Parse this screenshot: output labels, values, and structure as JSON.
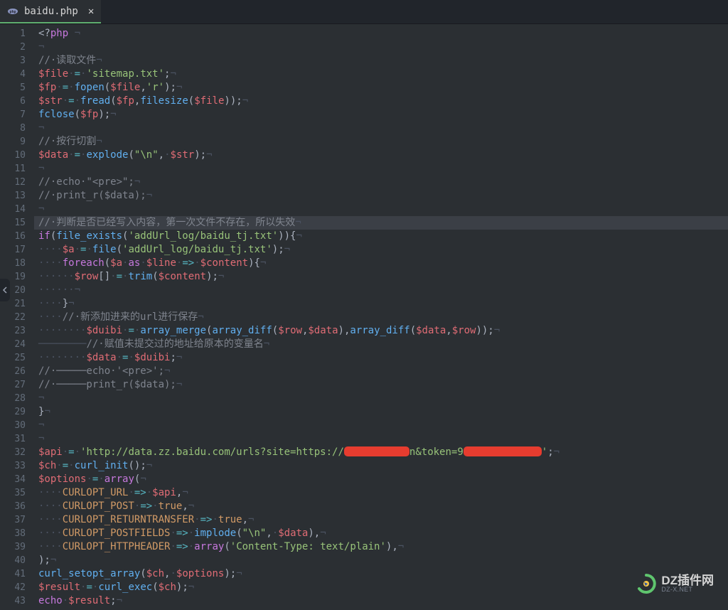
{
  "tab": {
    "filename": "baidu.php",
    "close": "✕"
  },
  "watermark": {
    "main": "DZ插件网",
    "sub": "DZ-X.NET"
  },
  "lines": [
    {
      "n": 1,
      "seg": [
        {
          "c": "t-pl",
          "t": "<?"
        },
        {
          "c": "t-kw",
          "t": "php"
        },
        {
          "c": "t-ws",
          "t": " ¬"
        }
      ]
    },
    {
      "n": 2,
      "seg": [
        {
          "c": "t-ws",
          "t": "¬"
        }
      ]
    },
    {
      "n": 3,
      "seg": [
        {
          "c": "t-cm",
          "t": "//·读取文件"
        },
        {
          "c": "t-ws",
          "t": "¬"
        }
      ]
    },
    {
      "n": 4,
      "seg": [
        {
          "c": "t-var",
          "t": "$file"
        },
        {
          "c": "t-ws",
          "t": "·"
        },
        {
          "c": "t-op",
          "t": "="
        },
        {
          "c": "t-ws",
          "t": "·"
        },
        {
          "c": "t-str",
          "t": "'sitemap.txt'"
        },
        {
          "c": "t-pl",
          "t": ";"
        },
        {
          "c": "t-ws",
          "t": "¬"
        }
      ]
    },
    {
      "n": 5,
      "seg": [
        {
          "c": "t-var",
          "t": "$fp"
        },
        {
          "c": "t-ws",
          "t": "·"
        },
        {
          "c": "t-op",
          "t": "="
        },
        {
          "c": "t-ws",
          "t": "·"
        },
        {
          "c": "t-fn",
          "t": "fopen"
        },
        {
          "c": "t-pl",
          "t": "("
        },
        {
          "c": "t-var",
          "t": "$file"
        },
        {
          "c": "t-pl",
          "t": ","
        },
        {
          "c": "t-str",
          "t": "'r'"
        },
        {
          "c": "t-pl",
          "t": ");"
        },
        {
          "c": "t-ws",
          "t": "¬"
        }
      ]
    },
    {
      "n": 6,
      "seg": [
        {
          "c": "t-var",
          "t": "$str"
        },
        {
          "c": "t-ws",
          "t": "·"
        },
        {
          "c": "t-op",
          "t": "="
        },
        {
          "c": "t-ws",
          "t": "·"
        },
        {
          "c": "t-fn",
          "t": "fread"
        },
        {
          "c": "t-pl",
          "t": "("
        },
        {
          "c": "t-var",
          "t": "$fp"
        },
        {
          "c": "t-pl",
          "t": ","
        },
        {
          "c": "t-fn",
          "t": "filesize"
        },
        {
          "c": "t-pl",
          "t": "("
        },
        {
          "c": "t-var",
          "t": "$file"
        },
        {
          "c": "t-pl",
          "t": "));"
        },
        {
          "c": "t-ws",
          "t": "¬"
        }
      ]
    },
    {
      "n": 7,
      "seg": [
        {
          "c": "t-fn",
          "t": "fclose"
        },
        {
          "c": "t-pl",
          "t": "("
        },
        {
          "c": "t-var",
          "t": "$fp"
        },
        {
          "c": "t-pl",
          "t": ");"
        },
        {
          "c": "t-ws",
          "t": "¬"
        }
      ]
    },
    {
      "n": 8,
      "seg": [
        {
          "c": "t-ws",
          "t": "¬"
        }
      ]
    },
    {
      "n": 9,
      "seg": [
        {
          "c": "t-cm",
          "t": "//·按行切割"
        },
        {
          "c": "t-ws",
          "t": "¬"
        }
      ]
    },
    {
      "n": 10,
      "seg": [
        {
          "c": "t-var",
          "t": "$data"
        },
        {
          "c": "t-ws",
          "t": "·"
        },
        {
          "c": "t-op",
          "t": "="
        },
        {
          "c": "t-ws",
          "t": "·"
        },
        {
          "c": "t-fn",
          "t": "explode"
        },
        {
          "c": "t-pl",
          "t": "("
        },
        {
          "c": "t-str",
          "t": "\"\\n\""
        },
        {
          "c": "t-pl",
          "t": ","
        },
        {
          "c": "t-ws",
          "t": "·"
        },
        {
          "c": "t-var",
          "t": "$str"
        },
        {
          "c": "t-pl",
          "t": ");"
        },
        {
          "c": "t-ws",
          "t": "¬"
        }
      ]
    },
    {
      "n": 11,
      "seg": [
        {
          "c": "t-ws",
          "t": "¬"
        }
      ]
    },
    {
      "n": 12,
      "seg": [
        {
          "c": "t-cm",
          "t": "//·echo·\"<pre>\";"
        },
        {
          "c": "t-ws",
          "t": "¬"
        }
      ]
    },
    {
      "n": 13,
      "seg": [
        {
          "c": "t-cm",
          "t": "//·print_r($data);"
        },
        {
          "c": "t-ws",
          "t": "¬"
        }
      ]
    },
    {
      "n": 14,
      "seg": [
        {
          "c": "t-ws",
          "t": "¬"
        }
      ]
    },
    {
      "n": 15,
      "hl": true,
      "seg": [
        {
          "c": "t-cm",
          "t": "//·判断是否已经写入内容，第一次文件不存在，所以失效"
        },
        {
          "c": "t-ws",
          "t": "¬"
        }
      ]
    },
    {
      "n": 16,
      "fold": true,
      "seg": [
        {
          "c": "t-kw",
          "t": "if"
        },
        {
          "c": "t-pl",
          "t": "("
        },
        {
          "c": "t-fn",
          "t": "file_exists"
        },
        {
          "c": "t-pl",
          "t": "("
        },
        {
          "c": "t-str",
          "t": "'addUrl_log/baidu_tj.txt'"
        },
        {
          "c": "t-pl",
          "t": ")){"
        },
        {
          "c": "t-ws",
          "t": "¬"
        }
      ]
    },
    {
      "n": 17,
      "seg": [
        {
          "c": "t-ws",
          "t": "····"
        },
        {
          "c": "t-var",
          "t": "$a"
        },
        {
          "c": "t-ws",
          "t": "·"
        },
        {
          "c": "t-op",
          "t": "="
        },
        {
          "c": "t-ws",
          "t": "·"
        },
        {
          "c": "t-fn",
          "t": "file"
        },
        {
          "c": "t-pl",
          "t": "("
        },
        {
          "c": "t-str",
          "t": "'addUrl_log/baidu_tj.txt'"
        },
        {
          "c": "t-pl",
          "t": ");"
        },
        {
          "c": "t-ws",
          "t": "¬"
        }
      ]
    },
    {
      "n": 18,
      "fold": true,
      "seg": [
        {
          "c": "t-ws",
          "t": "····"
        },
        {
          "c": "t-kw",
          "t": "foreach"
        },
        {
          "c": "t-pl",
          "t": "("
        },
        {
          "c": "t-var",
          "t": "$a"
        },
        {
          "c": "t-ws",
          "t": "·"
        },
        {
          "c": "t-kw",
          "t": "as"
        },
        {
          "c": "t-ws",
          "t": "·"
        },
        {
          "c": "t-var",
          "t": "$line"
        },
        {
          "c": "t-ws",
          "t": "·"
        },
        {
          "c": "t-op",
          "t": "=>"
        },
        {
          "c": "t-ws",
          "t": "·"
        },
        {
          "c": "t-var",
          "t": "$content"
        },
        {
          "c": "t-pl",
          "t": "){"
        },
        {
          "c": "t-ws",
          "t": "¬"
        }
      ]
    },
    {
      "n": 19,
      "seg": [
        {
          "c": "t-ws",
          "t": "······"
        },
        {
          "c": "t-var",
          "t": "$row"
        },
        {
          "c": "t-pl",
          "t": "[]"
        },
        {
          "c": "t-ws",
          "t": "·"
        },
        {
          "c": "t-op",
          "t": "="
        },
        {
          "c": "t-ws",
          "t": "·"
        },
        {
          "c": "t-fn",
          "t": "trim"
        },
        {
          "c": "t-pl",
          "t": "("
        },
        {
          "c": "t-var",
          "t": "$content"
        },
        {
          "c": "t-pl",
          "t": ");"
        },
        {
          "c": "t-ws",
          "t": "¬"
        }
      ]
    },
    {
      "n": 20,
      "seg": [
        {
          "c": "t-ws",
          "t": "······¬"
        }
      ]
    },
    {
      "n": 21,
      "seg": [
        {
          "c": "t-ws",
          "t": "····"
        },
        {
          "c": "t-pl",
          "t": "}"
        },
        {
          "c": "t-ws",
          "t": "¬"
        }
      ]
    },
    {
      "n": 22,
      "seg": [
        {
          "c": "t-ws",
          "t": "····"
        },
        {
          "c": "t-cm",
          "t": "//·新添加进来的url进行保存"
        },
        {
          "c": "t-ws",
          "t": "¬"
        }
      ]
    },
    {
      "n": 23,
      "seg": [
        {
          "c": "t-ws",
          "t": "········"
        },
        {
          "c": "t-var",
          "t": "$duibi"
        },
        {
          "c": "t-ws",
          "t": "·"
        },
        {
          "c": "t-op",
          "t": "="
        },
        {
          "c": "t-ws",
          "t": "·"
        },
        {
          "c": "t-fn",
          "t": "array_merge"
        },
        {
          "c": "t-pl",
          "t": "("
        },
        {
          "c": "t-fn",
          "t": "array_diff"
        },
        {
          "c": "t-pl",
          "t": "("
        },
        {
          "c": "t-var",
          "t": "$row"
        },
        {
          "c": "t-pl",
          "t": ","
        },
        {
          "c": "t-var",
          "t": "$data"
        },
        {
          "c": "t-pl",
          "t": "),"
        },
        {
          "c": "t-fn",
          "t": "array_diff"
        },
        {
          "c": "t-pl",
          "t": "("
        },
        {
          "c": "t-var",
          "t": "$data"
        },
        {
          "c": "t-pl",
          "t": ","
        },
        {
          "c": "t-var",
          "t": "$row"
        },
        {
          "c": "t-pl",
          "t": "));"
        },
        {
          "c": "t-ws",
          "t": "¬"
        }
      ]
    },
    {
      "n": 24,
      "seg": [
        {
          "c": "t-ws",
          "t": "────────"
        },
        {
          "c": "t-cm",
          "t": "//·赋值未提交过的地址给原本的变量名"
        },
        {
          "c": "t-ws",
          "t": "¬"
        }
      ]
    },
    {
      "n": 25,
      "seg": [
        {
          "c": "t-ws",
          "t": "········"
        },
        {
          "c": "t-var",
          "t": "$data"
        },
        {
          "c": "t-ws",
          "t": "·"
        },
        {
          "c": "t-op",
          "t": "="
        },
        {
          "c": "t-ws",
          "t": "·"
        },
        {
          "c": "t-var",
          "t": "$duibi"
        },
        {
          "c": "t-pl",
          "t": ";"
        },
        {
          "c": "t-ws",
          "t": "¬"
        }
      ]
    },
    {
      "n": 26,
      "seg": [
        {
          "c": "t-cm",
          "t": "//·─────echo·'<pre>';"
        },
        {
          "c": "t-ws",
          "t": "¬"
        }
      ]
    },
    {
      "n": 27,
      "seg": [
        {
          "c": "t-cm",
          "t": "//·─────print_r($data);"
        },
        {
          "c": "t-ws",
          "t": "¬"
        }
      ]
    },
    {
      "n": 28,
      "seg": [
        {
          "c": "t-ws",
          "t": "¬"
        }
      ]
    },
    {
      "n": 29,
      "seg": [
        {
          "c": "t-pl",
          "t": "}"
        },
        {
          "c": "t-ws",
          "t": "¬"
        }
      ]
    },
    {
      "n": 30,
      "seg": [
        {
          "c": "t-ws",
          "t": "¬"
        }
      ]
    },
    {
      "n": 31,
      "seg": [
        {
          "c": "t-ws",
          "t": "¬"
        }
      ]
    },
    {
      "n": 32,
      "seg": [
        {
          "c": "t-var",
          "t": "$api"
        },
        {
          "c": "t-ws",
          "t": "·"
        },
        {
          "c": "t-op",
          "t": "="
        },
        {
          "c": "t-ws",
          "t": "·"
        },
        {
          "c": "t-str",
          "t": "'http://data.zz.baidu.com/urls?site=https://"
        },
        {
          "c": "redact",
          "t": "",
          "w": 92
        },
        {
          "c": "t-str",
          "t": "n&token=9"
        },
        {
          "c": "redact",
          "t": "",
          "w": 110
        },
        {
          "c": "t-str",
          "t": "'"
        },
        {
          "c": "t-pl",
          "t": ";"
        },
        {
          "c": "t-ws",
          "t": "¬"
        }
      ]
    },
    {
      "n": 33,
      "seg": [
        {
          "c": "t-var",
          "t": "$ch"
        },
        {
          "c": "t-ws",
          "t": "·"
        },
        {
          "c": "t-op",
          "t": "="
        },
        {
          "c": "t-ws",
          "t": "·"
        },
        {
          "c": "t-fn",
          "t": "curl_init"
        },
        {
          "c": "t-pl",
          "t": "();"
        },
        {
          "c": "t-ws",
          "t": "¬"
        }
      ]
    },
    {
      "n": 34,
      "fold": true,
      "seg": [
        {
          "c": "t-var",
          "t": "$options"
        },
        {
          "c": "t-ws",
          "t": "·"
        },
        {
          "c": "t-op",
          "t": "="
        },
        {
          "c": "t-ws",
          "t": "·"
        },
        {
          "c": "t-kw",
          "t": "array"
        },
        {
          "c": "t-pl",
          "t": "("
        },
        {
          "c": "t-ws",
          "t": "¬"
        }
      ]
    },
    {
      "n": 35,
      "seg": [
        {
          "c": "t-ws",
          "t": "····"
        },
        {
          "c": "t-const",
          "t": "CURLOPT_URL"
        },
        {
          "c": "t-ws",
          "t": "·"
        },
        {
          "c": "t-op",
          "t": "=>"
        },
        {
          "c": "t-ws",
          "t": "·"
        },
        {
          "c": "t-var",
          "t": "$api"
        },
        {
          "c": "t-pl",
          "t": ","
        },
        {
          "c": "t-ws",
          "t": "¬"
        }
      ]
    },
    {
      "n": 36,
      "seg": [
        {
          "c": "t-ws",
          "t": "····"
        },
        {
          "c": "t-const",
          "t": "CURLOPT_POST"
        },
        {
          "c": "t-ws",
          "t": "·"
        },
        {
          "c": "t-op",
          "t": "=>"
        },
        {
          "c": "t-ws",
          "t": "·"
        },
        {
          "c": "t-const",
          "t": "true"
        },
        {
          "c": "t-pl",
          "t": ","
        },
        {
          "c": "t-ws",
          "t": "¬"
        }
      ]
    },
    {
      "n": 37,
      "seg": [
        {
          "c": "t-ws",
          "t": "····"
        },
        {
          "c": "t-const",
          "t": "CURLOPT_RETURNTRANSFER"
        },
        {
          "c": "t-ws",
          "t": "·"
        },
        {
          "c": "t-op",
          "t": "=>"
        },
        {
          "c": "t-ws",
          "t": "·"
        },
        {
          "c": "t-const",
          "t": "true"
        },
        {
          "c": "t-pl",
          "t": ","
        },
        {
          "c": "t-ws",
          "t": "¬"
        }
      ]
    },
    {
      "n": 38,
      "seg": [
        {
          "c": "t-ws",
          "t": "····"
        },
        {
          "c": "t-const",
          "t": "CURLOPT_POSTFIELDS"
        },
        {
          "c": "t-ws",
          "t": "·"
        },
        {
          "c": "t-op",
          "t": "=>"
        },
        {
          "c": "t-ws",
          "t": "·"
        },
        {
          "c": "t-fn",
          "t": "implode"
        },
        {
          "c": "t-pl",
          "t": "("
        },
        {
          "c": "t-str",
          "t": "\"\\n\""
        },
        {
          "c": "t-pl",
          "t": ","
        },
        {
          "c": "t-ws",
          "t": "·"
        },
        {
          "c": "t-var",
          "t": "$data"
        },
        {
          "c": "t-pl",
          "t": "),"
        },
        {
          "c": "t-ws",
          "t": "¬"
        }
      ]
    },
    {
      "n": 39,
      "seg": [
        {
          "c": "t-ws",
          "t": "····"
        },
        {
          "c": "t-const",
          "t": "CURLOPT_HTTPHEADER"
        },
        {
          "c": "t-ws",
          "t": "·"
        },
        {
          "c": "t-op",
          "t": "=>"
        },
        {
          "c": "t-ws",
          "t": "·"
        },
        {
          "c": "t-kw",
          "t": "array"
        },
        {
          "c": "t-pl",
          "t": "("
        },
        {
          "c": "t-str",
          "t": "'Content-Type: text/plain'"
        },
        {
          "c": "t-pl",
          "t": "),"
        },
        {
          "c": "t-ws",
          "t": "¬"
        }
      ]
    },
    {
      "n": 40,
      "seg": [
        {
          "c": "t-pl",
          "t": ");"
        },
        {
          "c": "t-ws",
          "t": "¬"
        }
      ]
    },
    {
      "n": 41,
      "seg": [
        {
          "c": "t-fn",
          "t": "curl_setopt_array"
        },
        {
          "c": "t-pl",
          "t": "("
        },
        {
          "c": "t-var",
          "t": "$ch"
        },
        {
          "c": "t-pl",
          "t": ","
        },
        {
          "c": "t-ws",
          "t": "·"
        },
        {
          "c": "t-var",
          "t": "$options"
        },
        {
          "c": "t-pl",
          "t": ");"
        },
        {
          "c": "t-ws",
          "t": "¬"
        }
      ]
    },
    {
      "n": 42,
      "seg": [
        {
          "c": "t-var",
          "t": "$result"
        },
        {
          "c": "t-ws",
          "t": "·"
        },
        {
          "c": "t-op",
          "t": "="
        },
        {
          "c": "t-ws",
          "t": "·"
        },
        {
          "c": "t-fn",
          "t": "curl_exec"
        },
        {
          "c": "t-pl",
          "t": "("
        },
        {
          "c": "t-var",
          "t": "$ch"
        },
        {
          "c": "t-pl",
          "t": ");"
        },
        {
          "c": "t-ws",
          "t": "¬"
        }
      ]
    },
    {
      "n": 43,
      "seg": [
        {
          "c": "t-kw",
          "t": "echo"
        },
        {
          "c": "t-ws",
          "t": "·"
        },
        {
          "c": "t-var",
          "t": "$result"
        },
        {
          "c": "t-pl",
          "t": ";"
        },
        {
          "c": "t-ws",
          "t": "¬"
        }
      ]
    }
  ]
}
